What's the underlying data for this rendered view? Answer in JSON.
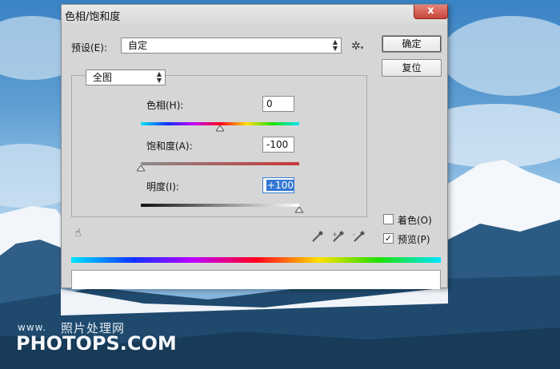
{
  "window": {
    "title": "色相/饱和度",
    "close_label": "x"
  },
  "preset": {
    "label": "预设(E):",
    "value": "自定"
  },
  "buttons": {
    "ok": "确定",
    "reset": "复位"
  },
  "channel": {
    "value": "全图"
  },
  "hue": {
    "label": "色相(H):",
    "value": "0",
    "level": 0.5
  },
  "saturation": {
    "label": "饱和度(A):",
    "value": "-100",
    "level": 0.0
  },
  "lightness": {
    "label": "明度(I):",
    "value": "+100",
    "level": 1.0
  },
  "options": {
    "colorize_label": "着色(O)",
    "colorize_checked": false,
    "preview_label": "预览(P)",
    "preview_checked": true
  },
  "icons": {
    "gear": "gear-icon",
    "hand": "targeted-adjustment-hand-icon",
    "eyedropper": "eyedropper-icon",
    "eyedropper_add": "eyedropper-plus-icon",
    "eyedropper_sub": "eyedropper-minus-icon"
  },
  "watermark": {
    "small": "www.",
    "cn": "照片处理网",
    "big": "PHOTOPS.COM"
  }
}
